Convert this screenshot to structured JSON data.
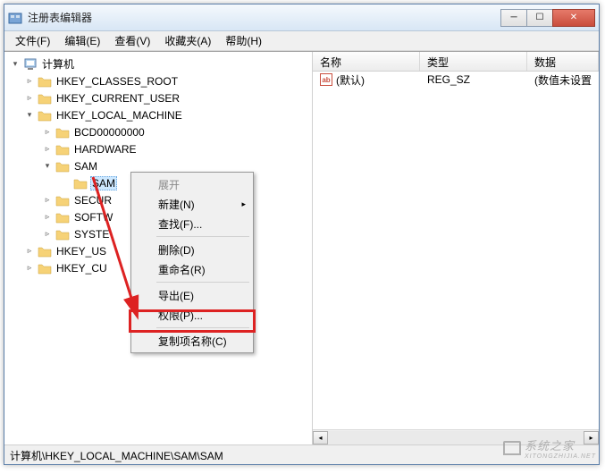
{
  "window": {
    "title": "注册表编辑器"
  },
  "menu": {
    "file": "文件(F)",
    "edit": "编辑(E)",
    "view": "查看(V)",
    "favorites": "收藏夹(A)",
    "help": "帮助(H)"
  },
  "tree": {
    "root": "计算机",
    "hkcr": "HKEY_CLASSES_ROOT",
    "hkcu": "HKEY_CURRENT_USER",
    "hklm": "HKEY_LOCAL_MACHINE",
    "bcd": "BCD00000000",
    "hardware": "HARDWARE",
    "sam": "SAM",
    "sam_sub": "SAM",
    "security": "SECUR",
    "software": "SOFTW",
    "system": "SYSTE",
    "hku": "HKEY_US",
    "hkcc": "HKEY_CU"
  },
  "list": {
    "col_name": "名称",
    "col_type": "类型",
    "col_data": "数据",
    "row_default_name": "(默认)",
    "row_default_type": "REG_SZ",
    "row_default_data": "(数值未设置"
  },
  "context_menu": {
    "expand": "展开",
    "new": "新建(N)",
    "find": "查找(F)...",
    "delete": "删除(D)",
    "rename": "重命名(R)",
    "export": "导出(E)",
    "permissions": "权限(P)...",
    "copy_key_name": "复制项名称(C)"
  },
  "statusbar": {
    "path": "计算机\\HKEY_LOCAL_MACHINE\\SAM\\SAM"
  },
  "watermark": {
    "text": "系统之家",
    "sub": "XITONGZHIJIA.NET"
  }
}
